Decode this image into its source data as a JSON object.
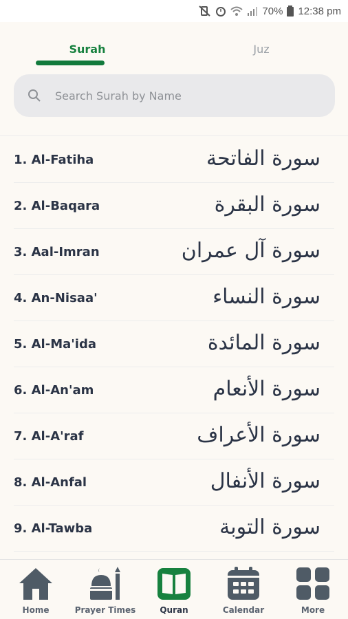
{
  "status_bar": {
    "battery": "70%",
    "time": "12:38 pm"
  },
  "tabs": [
    {
      "label": "Surah",
      "active": true
    },
    {
      "label": "Juz",
      "active": false
    }
  ],
  "search": {
    "placeholder": "Search Surah by Name",
    "value": ""
  },
  "surahs": [
    {
      "label": "1. Al-Fatiha",
      "arabic": "سورة الفاتحة"
    },
    {
      "label": "2. Al-Baqara",
      "arabic": "سورة البقرة"
    },
    {
      "label": "3. Aal-Imran",
      "arabic": "سورة آل عمران"
    },
    {
      "label": "4. An-Nisaa'",
      "arabic": "سورة النساء"
    },
    {
      "label": "5. Al-Ma'ida",
      "arabic": "سورة المائدة"
    },
    {
      "label": "6. Al-An'am",
      "arabic": "سورة الأنعام"
    },
    {
      "label": "7. Al-A'raf",
      "arabic": "سورة الأعراف"
    },
    {
      "label": "8. Al-Anfal",
      "arabic": "سورة الأنفال"
    },
    {
      "label": "9. Al-Tawba",
      "arabic": "سورة التوبة"
    }
  ],
  "bottom_nav": [
    {
      "label": "Home",
      "icon": "home-icon",
      "active": false
    },
    {
      "label": "Prayer Times",
      "icon": "mosque-icon",
      "active": false
    },
    {
      "label": "Quran",
      "icon": "quran-book-icon",
      "active": true
    },
    {
      "label": "Calendar",
      "icon": "calendar-icon",
      "active": false
    },
    {
      "label": "More",
      "icon": "grid-icon",
      "active": false
    }
  ],
  "colors": {
    "accent": "#17813f",
    "background": "#fcf9f4",
    "text": "#2b3446",
    "icon": "#4f5b66"
  }
}
